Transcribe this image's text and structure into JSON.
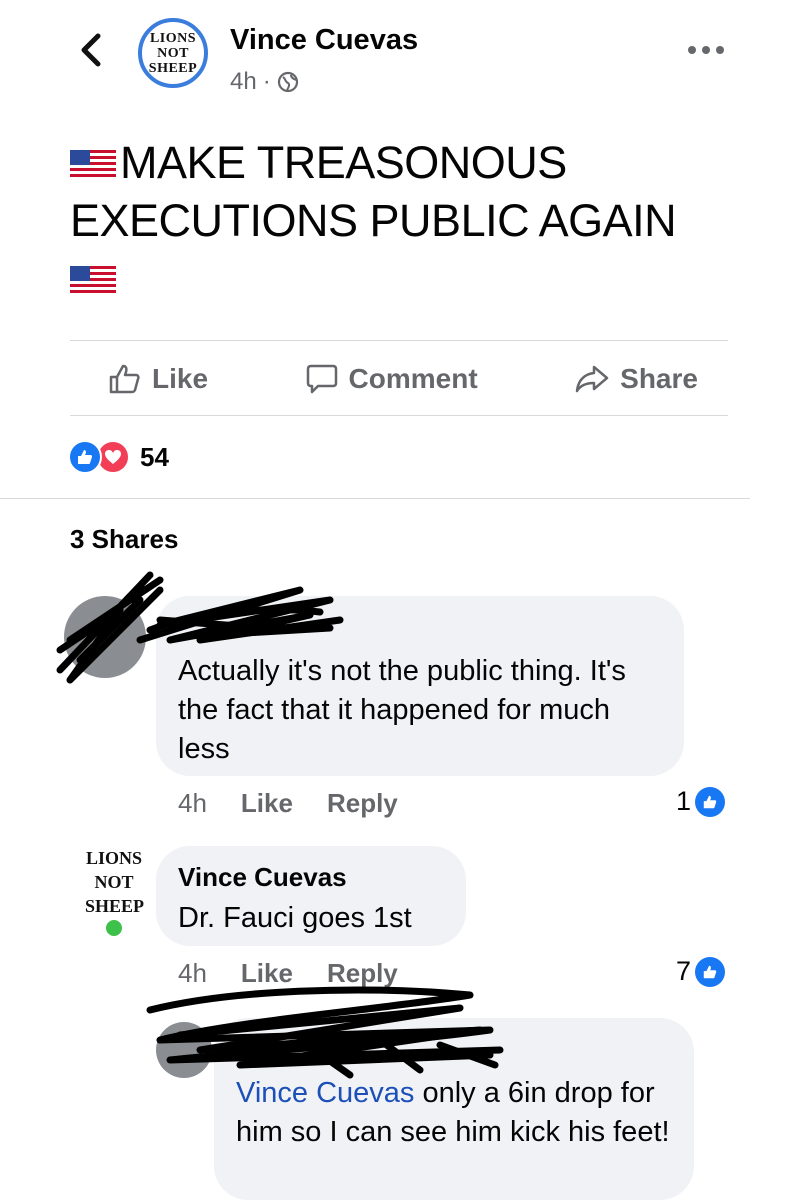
{
  "header": {
    "author": "Vince Cuevas",
    "time": "4h",
    "avatar_lines": [
      "LIONS",
      "NOT",
      "SHEEP"
    ]
  },
  "post": {
    "text": "MAKE TREASONOUS EXECUTIONS PUBLIC AGAIN"
  },
  "actions": {
    "like": "Like",
    "comment": "Comment",
    "share": "Share"
  },
  "reactions": {
    "count": "54"
  },
  "shares_label": "3 Shares",
  "comments": [
    {
      "author": "",
      "text": "Actually it's not the public thing. It's the fact that it happened for much less",
      "time": "4h",
      "like": "Like",
      "reply": "Reply",
      "likes": "1"
    },
    {
      "author": "Vince Cuevas",
      "text": "Dr. Fauci goes 1st",
      "time": "4h",
      "like": "Like",
      "reply": "Reply",
      "likes": "7",
      "avatar_lines": [
        "LIONS",
        "NOT",
        "SHEEP"
      ]
    },
    {
      "author": "",
      "mention": "Vince Cuevas",
      "text": " only a 6in drop for him so I can see him kick his feet!"
    }
  ],
  "colors": {
    "like_blue": "#1877f2",
    "love_red": "#f33e58",
    "online_green": "#3ec14a",
    "bubble_bg": "#f0f2f5",
    "secondary_text": "#65676b"
  }
}
